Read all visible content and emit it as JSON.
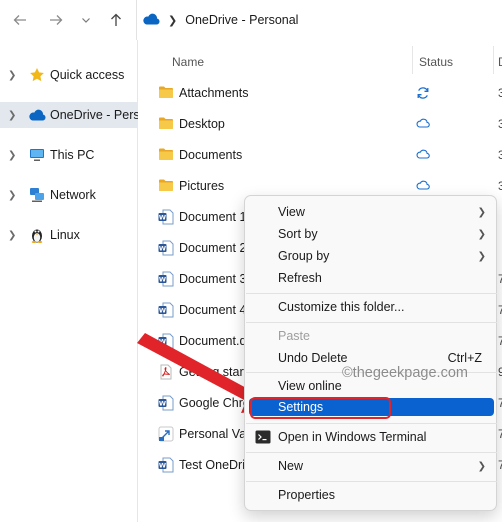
{
  "nav": {
    "back_icon": "arrow-left-icon",
    "forward_icon": "arrow-right-icon",
    "history_icon": "chevron-down-icon",
    "up_icon": "arrow-up-icon"
  },
  "address": {
    "location_icon": "onedrive-cloud-icon",
    "path": "OneDrive - Personal"
  },
  "sidebar": {
    "items": [
      {
        "label": "Quick access",
        "icon": "star-icon"
      },
      {
        "label": "OneDrive - Personal",
        "icon": "onedrive-cloud-icon",
        "selected": true
      },
      {
        "label": "This PC",
        "icon": "monitor-icon"
      },
      {
        "label": "Network",
        "icon": "network-icon"
      },
      {
        "label": "Linux",
        "icon": "penguin-icon"
      }
    ]
  },
  "columns": {
    "name": "Name",
    "status": "Status",
    "date": "D"
  },
  "files": [
    {
      "name": "Attachments",
      "type": "folder",
      "status": "syncing",
      "date": "3"
    },
    {
      "name": "Desktop",
      "type": "folder",
      "status": "cloud",
      "date": "3"
    },
    {
      "name": "Documents",
      "type": "folder",
      "status": "cloud",
      "date": "3"
    },
    {
      "name": "Pictures",
      "type": "folder",
      "status": "cloud",
      "date": "3"
    },
    {
      "name": "Document 1",
      "type": "word",
      "status": "",
      "date": ""
    },
    {
      "name": "Document 2",
      "type": "word",
      "status": "",
      "date": ""
    },
    {
      "name": "Document 3",
      "type": "word",
      "status": "",
      "date": "7"
    },
    {
      "name": "Document 4",
      "type": "word",
      "status": "",
      "date": "7"
    },
    {
      "name": "Document.d",
      "type": "word",
      "status": "",
      "date": "7"
    },
    {
      "name": "Getting start",
      "type": "pdf",
      "status": "",
      "date": "9"
    },
    {
      "name": "Google Chro",
      "type": "word",
      "status": "",
      "date": "7"
    },
    {
      "name": "Personal Vau",
      "type": "shortcut",
      "status": "",
      "date": "7"
    },
    {
      "name": "Test OneDrive",
      "type": "word",
      "status": "",
      "date": "7"
    }
  ],
  "context_menu": {
    "items": [
      {
        "label": "View",
        "submenu": true
      },
      {
        "label": "Sort by",
        "submenu": true
      },
      {
        "label": "Group by",
        "submenu": true
      },
      {
        "label": "Refresh"
      },
      {
        "label": "Customize this folder..."
      },
      {
        "label": "Paste",
        "disabled": true
      },
      {
        "label": "Undo Delete",
        "shortcut": "Ctrl+Z"
      },
      {
        "label": "View online"
      },
      {
        "label": "Settings",
        "highlighted": true
      },
      {
        "label": "Open in Windows Terminal",
        "icon": "terminal-icon"
      },
      {
        "label": "New",
        "submenu": true
      },
      {
        "label": "Properties"
      }
    ]
  },
  "watermark": "©thegeekpage.com",
  "colors": {
    "selection": "#e3e8ef",
    "menu_highlight": "#0a62d1",
    "annotation": "#e0242a",
    "folder": "#f5c342",
    "onedrive": "#0a66c2",
    "word": "#2b5797"
  }
}
